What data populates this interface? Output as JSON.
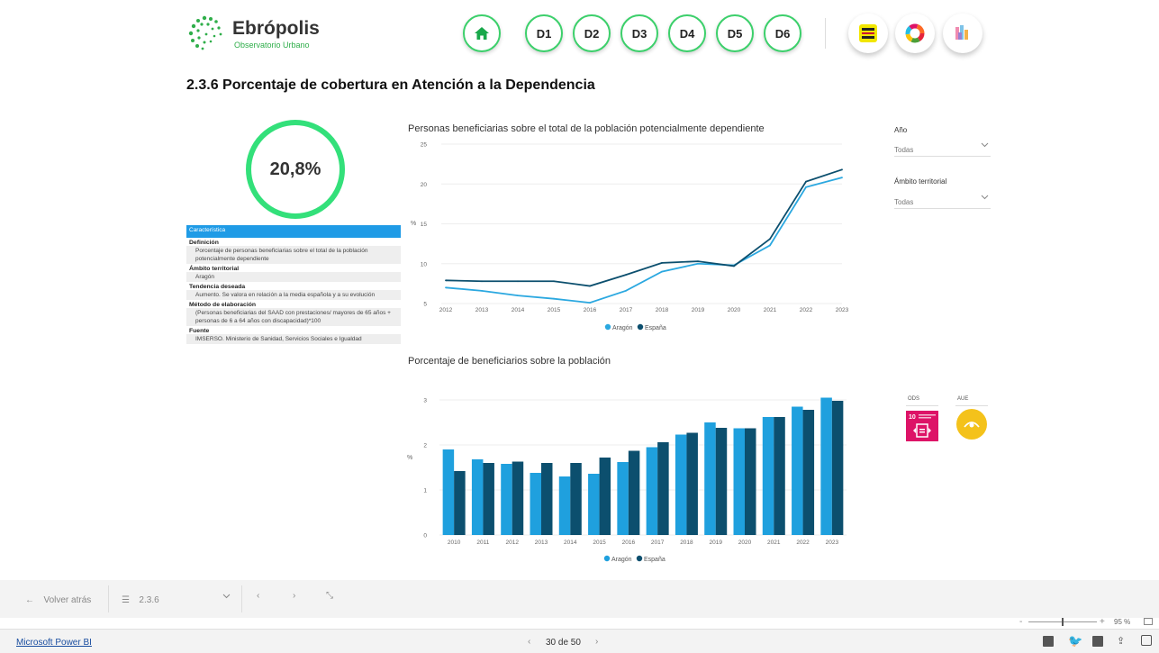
{
  "header": {
    "logo_title": "Ebrópolis",
    "logo_subtitle": "Observatorio Urbano",
    "nav": [
      "D1",
      "D2",
      "D3",
      "D4",
      "D5",
      "D6"
    ],
    "home_icon": "home-icon",
    "badges": [
      "agenda-2030-icon",
      "ods-wheel-icon",
      "agenda-urbana-icon"
    ]
  },
  "page": {
    "title": "2.3.6 Porcentaje de cobertura en Atención a la Dependencia"
  },
  "kpi": {
    "value": "20,8%",
    "ring_color": "#33e07a"
  },
  "info": {
    "header": "Característica",
    "rows": [
      {
        "label": "Definición",
        "value": "Porcentaje de personas beneficiarias sobre el total de la población potencialmente dependiente"
      },
      {
        "label": "Ámbito territorial",
        "value": "Aragón"
      },
      {
        "label": "Tendencia deseada",
        "value": "Aumento. Se valora en relación a la media española y a su evolución"
      },
      {
        "label": "Método de elaboración",
        "value": "(Personas beneficiarias del SAAD con prestaciones/ mayores de 65 años + personas de 6 a 64 años con discapacidad)*100"
      },
      {
        "label": "Fuente",
        "value": "IMSERSO. Ministerio de Sanidad, Servicios Sociales e Igualdad"
      }
    ]
  },
  "slicers": {
    "year": {
      "label": "Año",
      "value": "Todas"
    },
    "territory": {
      "label": "Ámbito territorial",
      "value": "Todas"
    }
  },
  "tags": {
    "ods": "ODS",
    "aue": "AUE"
  },
  "chart_data": [
    {
      "type": "line",
      "title": "Personas beneficiarias sobre el total de la población potencialmente dependiente",
      "ylabel": "%",
      "x": [
        "2012",
        "2013",
        "2014",
        "2015",
        "2016",
        "2017",
        "2018",
        "2019",
        "2020",
        "2021",
        "2022",
        "2023"
      ],
      "ylim": [
        5,
        25
      ],
      "yticks": [
        "5",
        "10",
        "15",
        "20",
        "25"
      ],
      "series": [
        {
          "name": "Aragón",
          "color": "#2ba8e0",
          "values": [
            7.0,
            6.6,
            6.0,
            5.6,
            5.1,
            6.6,
            9.0,
            10.0,
            9.8,
            12.3,
            19.6,
            20.8
          ]
        },
        {
          "name": "España",
          "color": "#0c4f6e",
          "values": [
            7.9,
            7.8,
            7.8,
            7.8,
            7.2,
            8.6,
            10.1,
            10.3,
            9.7,
            13.1,
            20.3,
            21.8
          ]
        }
      ],
      "legend": "bottom-center",
      "grid": true
    },
    {
      "type": "bar",
      "title": "Porcentaje de beneficiarios sobre la población",
      "ylabel": "%",
      "categories": [
        "2010",
        "2011",
        "2012",
        "2013",
        "2014",
        "2015",
        "2016",
        "2017",
        "2018",
        "2019",
        "2020",
        "2021",
        "2022",
        "2023"
      ],
      "ylim": [
        0,
        3.2
      ],
      "yticks": [
        "0",
        "1",
        "2",
        "3"
      ],
      "series": [
        {
          "name": "Aragón",
          "color": "#1fa0de",
          "values": [
            1.9,
            1.68,
            1.58,
            1.38,
            1.3,
            1.36,
            1.62,
            1.95,
            2.23,
            2.5,
            2.37,
            2.62,
            2.85,
            3.05
          ]
        },
        {
          "name": "España",
          "color": "#0c4f6e",
          "values": [
            1.42,
            1.6,
            1.63,
            1.6,
            1.6,
            1.72,
            1.87,
            2.06,
            2.27,
            2.38,
            2.37,
            2.62,
            2.78,
            2.98
          ]
        }
      ],
      "legend": "bottom-center",
      "grid": true
    }
  ],
  "footer": {
    "back": "Volver atrás",
    "page_menu": "2.3.6",
    "powerbi": "Microsoft Power BI",
    "pager": "30 de 50",
    "zoom": "95 %"
  }
}
